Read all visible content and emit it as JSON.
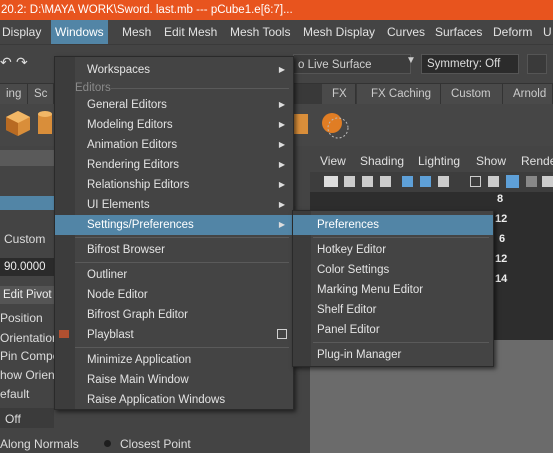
{
  "title": "20.2: D:\\MAYA WORK\\Sword. last.mb   ---   pCube1.e[6:7]...",
  "menubar": [
    "Display",
    "Windows",
    "Mesh",
    "Edit Mesh",
    "Mesh Tools",
    "Mesh Display",
    "Curves",
    "Surfaces",
    "Deform",
    "U"
  ],
  "status": {
    "live_surface": "o Live Surface",
    "symmetry": "Symmetry: Off"
  },
  "shelf_tabs": [
    "ing",
    "Sc",
    "FX",
    "FX Caching",
    "Custom",
    "Arnold"
  ],
  "left_panel": {
    "custom": "Custom",
    "value": "90.0000",
    "edit_pivot": "Edit Pivot",
    "position": "Position",
    "orientation": "Orientation",
    "pin_component": "Pin Compo",
    "show_orient": "how Orien",
    "default": "efault",
    "off": "Off",
    "along_normals": "Along Normals",
    "closest_point": "Closest Point"
  },
  "viewport": {
    "menus": [
      "View",
      "Shading",
      "Lighting",
      "Show",
      "Rende"
    ],
    "numbers": [
      "8",
      "12",
      "6",
      "12",
      "14"
    ]
  },
  "windows_menu": {
    "items": [
      {
        "label": "Workspaces",
        "arrow": true
      },
      {
        "label": "General Editors",
        "arrow": true
      },
      {
        "label": "Modeling Editors",
        "arrow": true
      },
      {
        "label": "Animation Editors",
        "arrow": true
      },
      {
        "label": "Rendering Editors",
        "arrow": true
      },
      {
        "label": "Relationship Editors",
        "arrow": true
      },
      {
        "label": "UI Elements",
        "arrow": true
      },
      {
        "label": "Settings/Preferences",
        "arrow": true
      },
      {
        "label": "Bifrost Browser"
      },
      {
        "label": "Outliner"
      },
      {
        "label": "Node Editor"
      },
      {
        "label": "Bifrost Graph Editor"
      },
      {
        "label": "Playblast"
      },
      {
        "label": "Minimize Application"
      },
      {
        "label": "Raise Main Window"
      },
      {
        "label": "Raise Application Windows"
      }
    ],
    "editors_section": "Editors",
    "highlighted": "Settings/Preferences"
  },
  "settings_submenu": {
    "items": [
      "Preferences",
      "Hotkey Editor",
      "Color Settings",
      "Marking Menu Editor",
      "Shelf Editor",
      "Panel Editor",
      "Plug-in Manager"
    ],
    "highlighted": "Preferences"
  },
  "colors": {
    "title_bar": "#e8541e",
    "highlight": "#5285a6",
    "menu_bg": "#444444"
  }
}
